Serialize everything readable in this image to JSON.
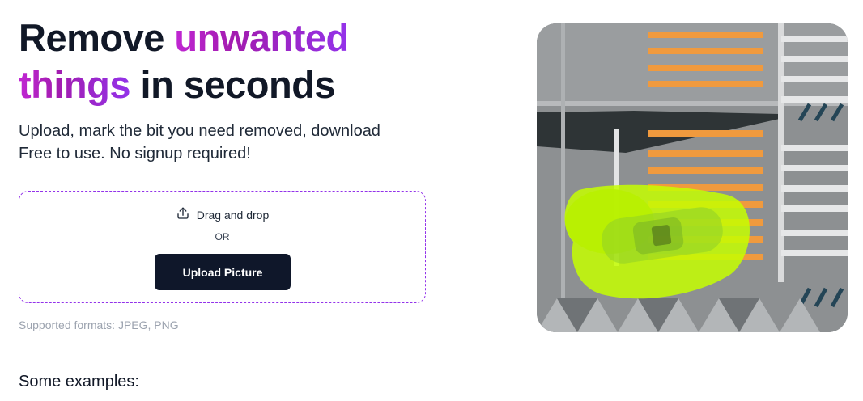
{
  "headline": {
    "part1": "Remove ",
    "accent1": "unwanted",
    "accent2": "things",
    "part2": " in seconds"
  },
  "subtitle": {
    "line1": "Upload, mark the bit you need removed, download",
    "line2": "Free to use. No signup required!"
  },
  "dropzone": {
    "icon": "upload-icon",
    "drag_text": "Drag and drop",
    "or_text": "OR",
    "upload_label": "Upload Picture"
  },
  "supported_formats": "Supported formats: JPEG, PNG",
  "examples_heading": "Some examples:",
  "colors": {
    "accent": "#c026d3",
    "accent_end": "#9333ea",
    "button_bg": "#0f172a",
    "dropzone_border": "#9333ea",
    "highlight_mask": "#c6ff00"
  }
}
